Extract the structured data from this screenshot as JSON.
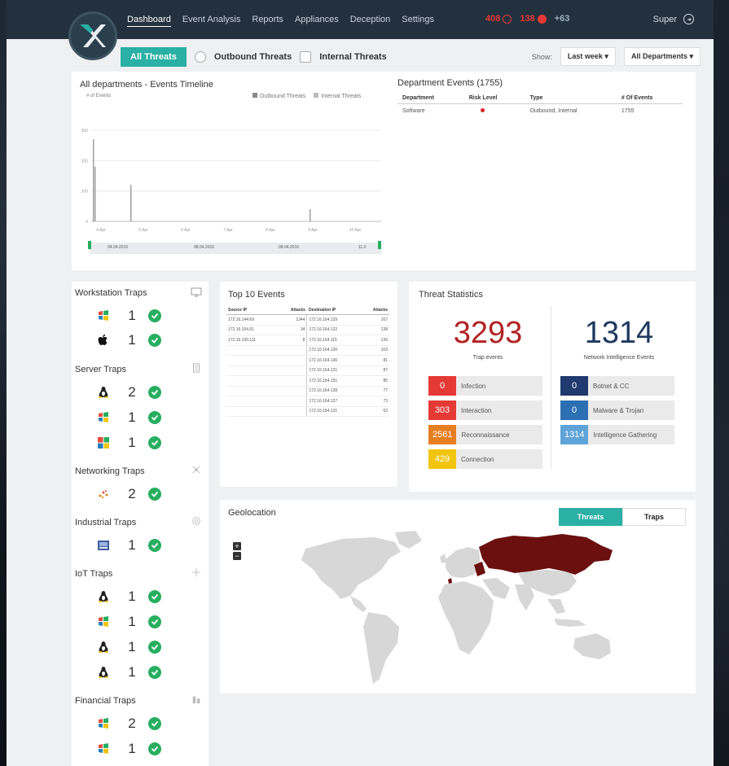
{
  "nav": {
    "items": [
      "Dashboard",
      "Event Analysis",
      "Reports",
      "Appliances",
      "Deception",
      "Settings"
    ],
    "active": "Dashboard"
  },
  "alerts": {
    "a1": "408",
    "a2": "138",
    "a3": "+63"
  },
  "user": {
    "name": "Super"
  },
  "filters": {
    "all": "All Threats",
    "outbound": "Outbound Threats",
    "internal": "Internal Threats",
    "show_label": "Show:",
    "period": "Last week",
    "departments": "All Departments"
  },
  "timeline": {
    "title": "All departments - Events Timeline",
    "ylabel": "# of Events",
    "legend_outbound": "Outbound Threats",
    "legend_internal": "Internal Threats",
    "yticks": [
      "300",
      "200",
      "100",
      "0"
    ],
    "xticks": [
      "4 Apr",
      "5 Apr",
      "6 Apr",
      "7 Apr",
      "8 Apr",
      "9 Apr",
      "10 Apr"
    ],
    "range": [
      "04.04.2016",
      "08.04.2016",
      "08.04.2016",
      "11.0"
    ]
  },
  "chart_data": {
    "type": "bar",
    "title": "All departments - Events Timeline",
    "ylabel": "# of Events",
    "ylim": [
      0,
      300
    ],
    "x": [
      "4 Apr",
      "4 Apr",
      "5 Apr",
      "9 Apr"
    ],
    "series": [
      {
        "values": [
          270,
          180,
          120,
          40
        ]
      }
    ]
  },
  "dept_events": {
    "title": "Department Events (1755)",
    "headers": [
      "Department",
      "Risk Level",
      "Type",
      "# Of Events"
    ],
    "rows": [
      [
        "Software",
        "",
        "Outbound, Internal",
        "1755"
      ]
    ]
  },
  "traps": {
    "workstation": {
      "title": "Workstation Traps",
      "rows": [
        {
          "os": "windows-xp",
          "count": "1"
        },
        {
          "os": "apple",
          "count": "1"
        }
      ]
    },
    "server": {
      "title": "Server Traps",
      "rows": [
        {
          "os": "linux",
          "count": "2"
        },
        {
          "os": "windows-xp",
          "count": "1"
        },
        {
          "os": "windows-8",
          "count": "1"
        }
      ]
    },
    "networking": {
      "title": "Networking Traps",
      "rows": [
        {
          "os": "network",
          "count": "2"
        }
      ]
    },
    "industrial": {
      "title": "Industrial Traps",
      "rows": [
        {
          "os": "industrial",
          "count": "1"
        }
      ]
    },
    "iot": {
      "title": "IoT Traps",
      "rows": [
        {
          "os": "linux",
          "count": "1"
        },
        {
          "os": "windows-xp",
          "count": "1"
        },
        {
          "os": "linux",
          "count": "1"
        },
        {
          "os": "linux",
          "count": "1"
        }
      ]
    },
    "financial": {
      "title": "Financial Traps",
      "rows": [
        {
          "os": "windows-xp",
          "count": "2"
        },
        {
          "os": "windows-xp",
          "count": "1"
        }
      ]
    }
  },
  "top10": {
    "title": "Top 10 Events",
    "headers": [
      "Source IP",
      "Attacks",
      "Destination IP",
      "Attacks"
    ],
    "rows": [
      [
        "172.16.144.69",
        "1344",
        "172.16.164.129",
        "167"
      ],
      [
        "172.16.154.51",
        "34",
        "172.16.164.122",
        "138"
      ],
      [
        "172.16.100.111",
        "8",
        "172.16.164.115",
        "130"
      ],
      [
        "",
        "",
        "172.16.164.126",
        "103"
      ],
      [
        "",
        "",
        "172.16.164.136",
        "81"
      ],
      [
        "",
        "",
        "172.16.164.121",
        "87"
      ],
      [
        "",
        "",
        "172.16.164.151",
        "85"
      ],
      [
        "",
        "",
        "172.16.164.128",
        "77"
      ],
      [
        "",
        "",
        "172.16.164.127",
        "73"
      ],
      [
        "",
        "",
        "172.16.164.131",
        "63"
      ]
    ]
  },
  "threat_stats": {
    "title": "Threat Statistics",
    "trap_events": "3293",
    "trap_label": "Trap events",
    "intel_events": "1314",
    "intel_label": "Network Intelligence Events",
    "left": [
      {
        "value": "0",
        "label": "Infection",
        "color": "#e53935"
      },
      {
        "value": "303",
        "label": "Interaction",
        "color": "#e53935"
      },
      {
        "value": "2561",
        "label": "Reconnaissance",
        "color": "#e67e22"
      },
      {
        "value": "429",
        "label": "Connection",
        "color": "#f1c40f"
      }
    ],
    "right": [
      {
        "value": "0",
        "label": "Botnet & CC",
        "color": "#1f3a6e"
      },
      {
        "value": "0",
        "label": "Malware & Trojan",
        "color": "#2d6fb3"
      },
      {
        "value": "1314",
        "label": "Intelligence Gathering",
        "color": "#5fa4d8"
      }
    ]
  },
  "geo": {
    "title": "Geolocation",
    "tab_threats": "Threats",
    "tab_traps": "Traps",
    "highlight_color": "#6b0f0f"
  },
  "colors": {
    "accent": "#2ab0a4",
    "topbar": "#23303e",
    "title_red": "#b22222",
    "title_blue": "#1e3a5f"
  }
}
